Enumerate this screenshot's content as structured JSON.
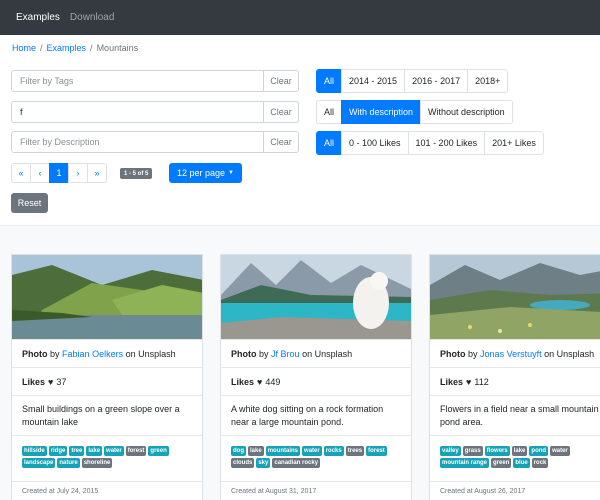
{
  "nav": {
    "examples": "Examples",
    "download": "Download"
  },
  "breadcrumb": {
    "home": "Home",
    "sep1": "/",
    "examples": "Examples",
    "sep2": "/",
    "current": "Mountains"
  },
  "filters": {
    "tags": {
      "placeholder": "Filter by Tags",
      "value": "",
      "clear": "Clear"
    },
    "text": {
      "placeholder": "",
      "value": "f",
      "clear": "Clear"
    },
    "description": {
      "placeholder": "Filter by Description",
      "value": "",
      "clear": "Clear"
    }
  },
  "year_group": {
    "options": [
      "All",
      "2014 - 2015",
      "2016 - 2017",
      "2018+"
    ],
    "active": 0
  },
  "desc_group": {
    "options": [
      "All",
      "With description",
      "Without description"
    ],
    "active": 1
  },
  "likes_group": {
    "options": [
      "All",
      "0 - 100 Likes",
      "101 - 200 Likes",
      "201+ Likes"
    ],
    "active": 0
  },
  "pagination": {
    "first": "«",
    "prev": "‹",
    "page": "1",
    "next": "›",
    "last": "»",
    "count": "1 - 5 of 5"
  },
  "per_page": {
    "label": "12 per page",
    "caret": "▼"
  },
  "reset": "Reset",
  "cards": [
    {
      "photo_prefix": "Photo",
      "by": "by",
      "author": "Fabian Oelkers",
      "on": "on Unsplash",
      "likes_label": "Likes",
      "likes": "37",
      "description": "Small buildings on a green slope over a mountain lake",
      "tags": [
        "hillside",
        "ridge",
        "tree",
        "lake",
        "water",
        "forest",
        "green",
        "landscape",
        "nature",
        "shoreline"
      ],
      "tag_styles": [
        "t",
        "t",
        "t",
        "t",
        "t",
        "s",
        "t",
        "t",
        "t",
        "s"
      ],
      "created": "Created at July 24, 2015"
    },
    {
      "photo_prefix": "Photo",
      "by": "by",
      "author": "Jf Brou",
      "on": "on Unsplash",
      "likes_label": "Likes",
      "likes": "449",
      "description": "A white dog sitting on a rock formation near a large mountain pond.",
      "tags": [
        "dog",
        "lake",
        "mountains",
        "water",
        "rocks",
        "trees",
        "forest",
        "clouds",
        "sky",
        "canadian rocky"
      ],
      "tag_styles": [
        "t",
        "s",
        "t",
        "t",
        "t",
        "s",
        "t",
        "s",
        "t",
        "s"
      ],
      "created": "Created at August 31, 2017"
    },
    {
      "photo_prefix": "Photo",
      "by": "by",
      "author": "Jonas Verstuyft",
      "on": "on Unsplash",
      "likes_label": "Likes",
      "likes": "112",
      "description": "Flowers in a field near a small mountain pond area.",
      "tags": [
        "valley",
        "grass",
        "flowers",
        "lake",
        "pond",
        "water",
        "mountain range",
        "green",
        "blue",
        "rock"
      ],
      "tag_styles": [
        "t",
        "s",
        "t",
        "s",
        "t",
        "s",
        "t",
        "s",
        "t",
        "s"
      ],
      "created": "Created at August 26, 2017"
    }
  ],
  "colors": {
    "accent": "#007bff",
    "navbar": "#343a40",
    "tag_teal": "#17a2b8",
    "tag_gray": "#6c757d"
  }
}
